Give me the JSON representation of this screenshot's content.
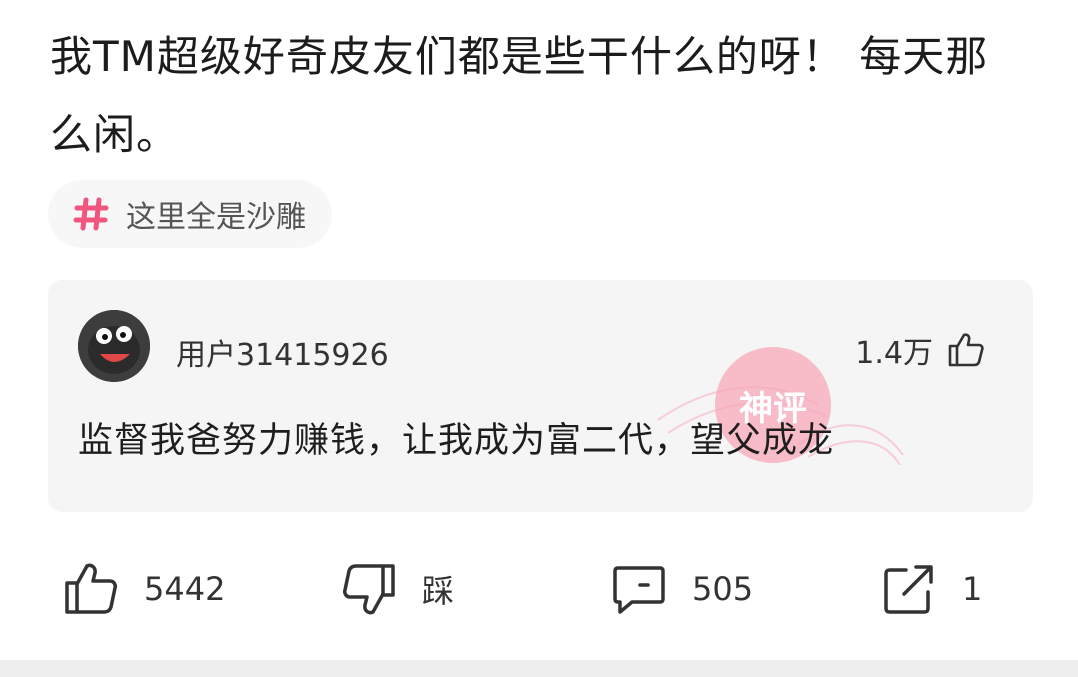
{
  "post": {
    "text": "我TM超级好奇皮友们都是些干什么的呀！ 每天那么闲。",
    "topic_tag": "这里全是沙雕"
  },
  "god_comment": {
    "username": "用户31415926",
    "like_count": "1.4万",
    "text": "监督我爸努力赚钱，让我成为富二代，望父成龙",
    "stamp_text": "神评"
  },
  "actions": {
    "like_count": "5442",
    "dislike_label": "踩",
    "comment_count": "505",
    "share_count": "1"
  },
  "colors": {
    "accent_pink": "#f0567e",
    "stamp_pink": "#f7a8b8",
    "comment_bg": "#f5f5f5"
  },
  "icons": {
    "topic": "hashtag-icon",
    "comment_like": "thumbs-up-icon",
    "like": "thumbs-up-icon",
    "dislike": "thumbs-down-icon",
    "comment": "comment-bubble-icon",
    "share": "share-icon"
  }
}
